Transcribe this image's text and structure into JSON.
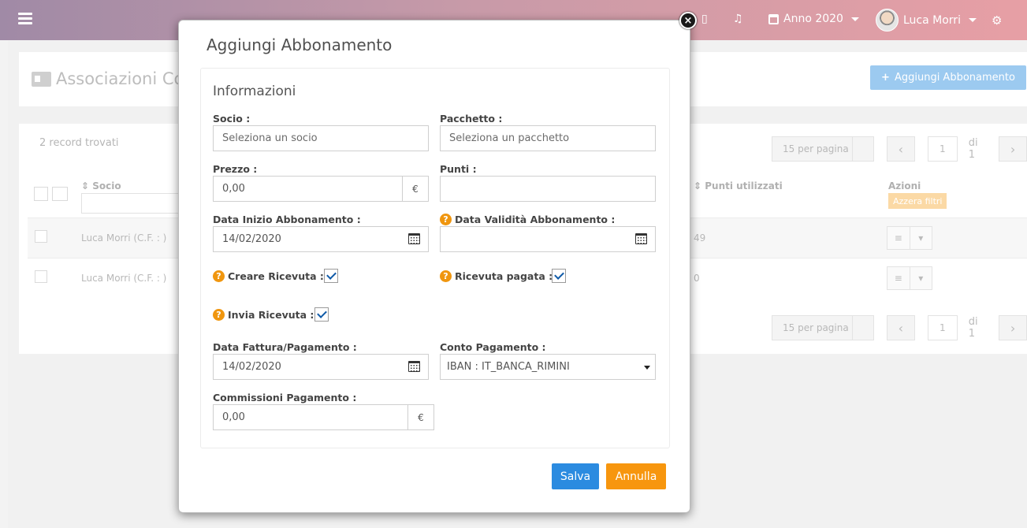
{
  "topbar": {
    "year_label": "Anno 2020",
    "user_name": "Luca Morri"
  },
  "background": {
    "page_title": "Associazioni Cor",
    "add_button": "Aggiungi Abbonamento",
    "records_found": "2 record trovati",
    "pagination": {
      "per_page": "15 per pagina",
      "page": "1",
      "of": "di 1"
    },
    "table": {
      "col_socio": "Socio",
      "col_punti": "Punti utilizzati",
      "col_azioni": "Azioni",
      "reset_filters": "Azzera filtri",
      "rows": [
        {
          "socio": "Luca Morri (C.F. : )",
          "punti": "49"
        },
        {
          "socio": "Luca Morri (C.F. : )",
          "punti": "0"
        }
      ]
    }
  },
  "modal": {
    "title": "Aggiungi Abbonamento",
    "section": "Informazioni",
    "socio": {
      "label": "Socio :",
      "placeholder": "Seleziona un socio"
    },
    "pacchetto": {
      "label": "Pacchetto :",
      "placeholder": "Seleziona un pacchetto"
    },
    "prezzo": {
      "label": "Prezzo :",
      "value": "0,00",
      "currency": "€"
    },
    "punti": {
      "label": "Punti :",
      "value": ""
    },
    "data_inizio": {
      "label": "Data Inizio Abbonamento :",
      "value": "14/02/2020"
    },
    "data_validita": {
      "label": "Data Validità Abbonamento :",
      "value": ""
    },
    "creare_ricevuta": {
      "label": "Creare Ricevuta :",
      "checked": true
    },
    "ricevuta_pagata": {
      "label": "Ricevuta pagata :",
      "checked": true
    },
    "invia_ricevuta": {
      "label": "Invia Ricevuta :",
      "checked": true
    },
    "data_fattura": {
      "label": "Data Fattura/Pagamento :",
      "value": "14/02/2020"
    },
    "conto_pagamento": {
      "label": "Conto Pagamento :",
      "value": "IBAN : IT_BANCA_RIMINI"
    },
    "commissioni": {
      "label": "Commissioni Pagamento :",
      "value": "0,00",
      "currency": "€"
    },
    "save_label": "Salva",
    "cancel_label": "Annulla",
    "close_symbol": "×"
  },
  "colors": {
    "primary": "#2b8be0",
    "warning": "#f7960e",
    "help": "#f0960f"
  }
}
